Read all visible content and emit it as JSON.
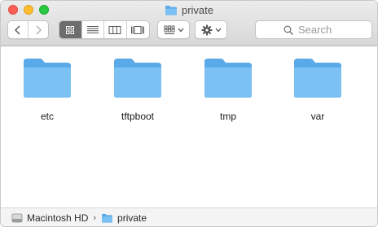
{
  "window": {
    "title": "private"
  },
  "toolbar": {
    "search_placeholder": "Search",
    "active_view": "icon"
  },
  "items": [
    {
      "name": "etc"
    },
    {
      "name": "tftpboot"
    },
    {
      "name": "tmp"
    },
    {
      "name": "var"
    }
  ],
  "pathbar": {
    "segments": [
      "Macintosh HD",
      "private"
    ]
  },
  "colors": {
    "folder_front": "#7cc1f3",
    "folder_back": "#5aaae9",
    "active_segment": "#6d6d6d"
  }
}
